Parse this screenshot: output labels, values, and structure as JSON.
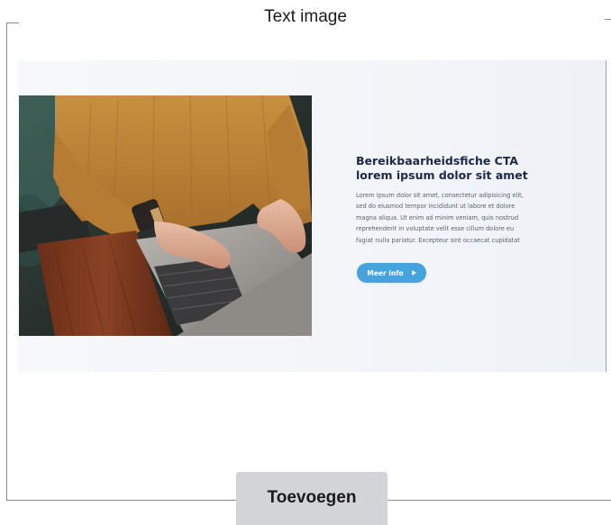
{
  "section": {
    "title": "Text image"
  },
  "preview": {
    "photo": {
      "description_icon": "person-laptop-photo"
    },
    "cta": {
      "title_line1": "Bereikbaarheidsfiche CTA",
      "title_line2": "lorem ipsum dolor sit amet",
      "body_lines": [
        "Lorem ipsum dolor sit amet, consectetur adipisicing elit,",
        "sed do eiusmod tempor incididunt ut labore et dolore",
        "magna aliqua. Ut enim ad minim veniam, quis nostrud",
        "reprehenderit in voluptate velit esse cillum dolore eu",
        "fugiat nulla pariatur. Excepteur sint occaecat cupidatat"
      ],
      "button_label": "Meer info",
      "button_icon": "play-icon",
      "accent_color": "#45a3de",
      "title_color": "#1c2a48"
    }
  },
  "footer": {
    "add_button_label": "Toevoegen"
  }
}
